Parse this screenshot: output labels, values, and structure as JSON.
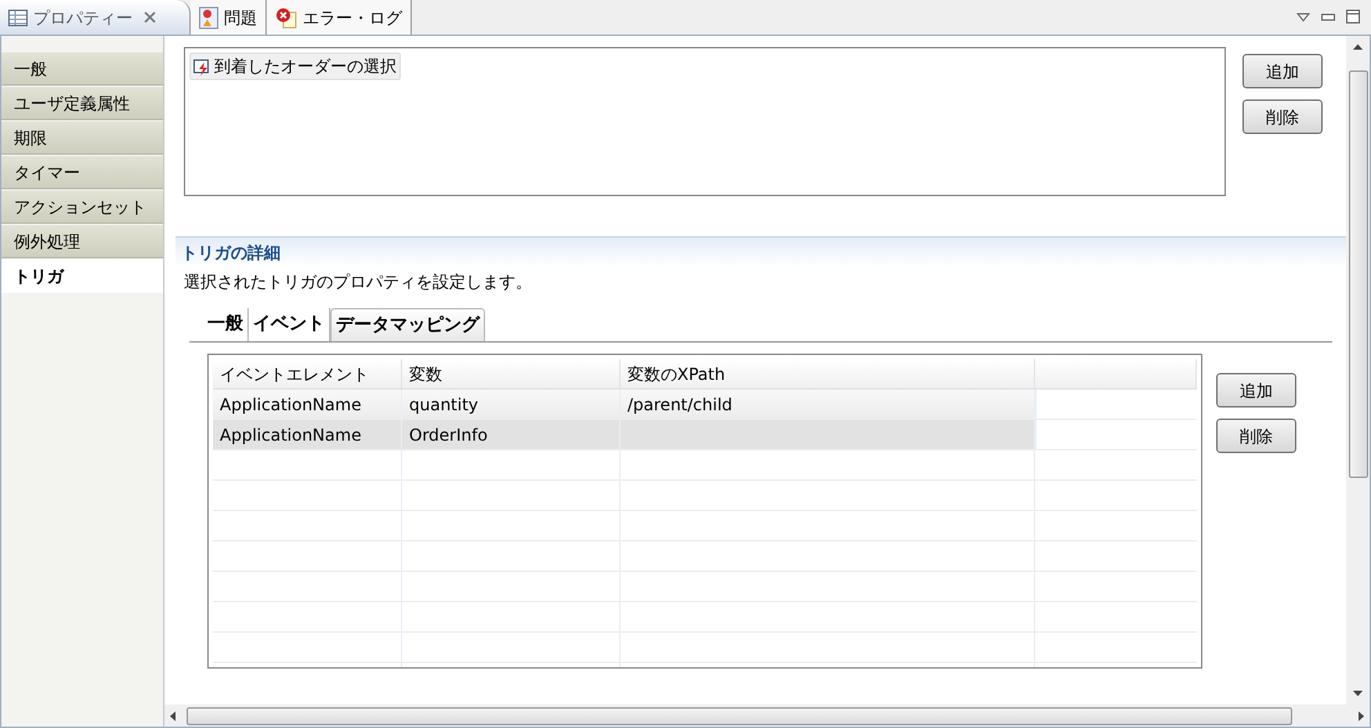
{
  "view_tabs": [
    {
      "label": "プロパティー",
      "selected": true
    },
    {
      "label": "問題",
      "selected": false
    },
    {
      "label": "エラー・ログ",
      "selected": false
    }
  ],
  "sidebar": {
    "items": [
      {
        "label": "一般",
        "selected": false
      },
      {
        "label": "ユーザ定義属性",
        "selected": false
      },
      {
        "label": "期限",
        "selected": false
      },
      {
        "label": "タイマー",
        "selected": false
      },
      {
        "label": "アクションセット",
        "selected": false
      },
      {
        "label": "例外処理",
        "selected": false
      },
      {
        "label": "トリガ",
        "selected": true
      }
    ]
  },
  "trigger_list": {
    "items": [
      {
        "label": "到着したオーダーの選択"
      }
    ],
    "buttons": [
      "追加",
      "削除"
    ]
  },
  "section": {
    "title": "トリガの詳細",
    "description": "選択されたトリガのプロパティを設定します。"
  },
  "inner_tabs": [
    {
      "label": "一般",
      "selected": false
    },
    {
      "label": "イベント",
      "selected": false
    },
    {
      "label": "データマッピング",
      "selected": true
    }
  ],
  "table": {
    "columns": [
      "イベントエレメント",
      "変数",
      "変数のXPath"
    ],
    "rows": [
      {
        "cells": [
          "ApplicationName",
          "quantity",
          "/parent/child"
        ],
        "selected": false
      },
      {
        "cells": [
          "ApplicationName",
          "OrderInfo",
          ""
        ],
        "selected": true
      }
    ],
    "buttons": [
      "追加",
      "削除"
    ]
  }
}
